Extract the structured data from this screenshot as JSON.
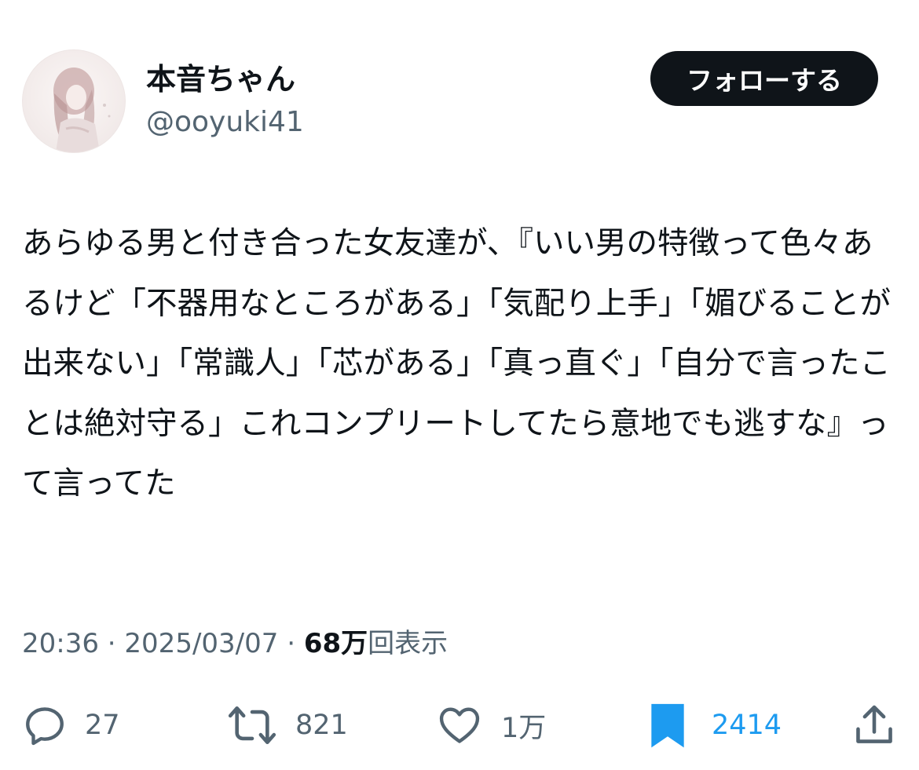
{
  "user": {
    "display_name": "本音ちゃん",
    "handle": "@ooyuki41"
  },
  "follow_button": {
    "label": "フォローする"
  },
  "tweet": {
    "text": "あらゆる男と付き合った女友達が、『いい男の特徴って色々あるけど「不器用なところがある」「気配り上手」「媚びることが出来ない」「常識人」「芯がある」「真っ直ぐ」「自分で言ったことは絶対守る」これコンプリートしてたら意地でも逃すな』って言ってた"
  },
  "meta": {
    "time": "20:36",
    "separator1": " · ",
    "date": "2025/03/07",
    "separator2": " · ",
    "views_count": "68万",
    "views_label": "回表示"
  },
  "actions": {
    "reply": {
      "icon": "reply-icon",
      "count": "27"
    },
    "retweet": {
      "icon": "retweet-icon",
      "count": "821"
    },
    "like": {
      "icon": "heart-icon",
      "count": "1万"
    },
    "bookmark": {
      "icon": "bookmark-icon",
      "count": "2414",
      "active": true
    },
    "share": {
      "icon": "share-icon"
    }
  },
  "colors": {
    "text": "#0f1419",
    "secondary": "#536471",
    "accent": "#1d9bf0",
    "button": "#0f1419"
  }
}
